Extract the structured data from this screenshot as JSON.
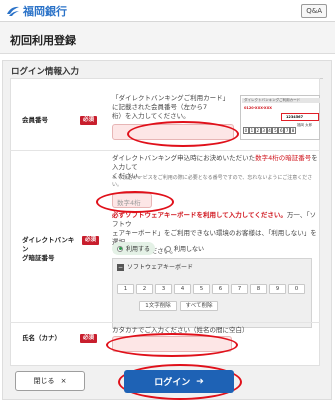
{
  "header": {
    "bank_name": "福岡銀行",
    "qa_label": "Q&A"
  },
  "page_title": "初回利用登録",
  "section_title": "ログイン情報入力",
  "member": {
    "label": "会員番号",
    "required": "必須",
    "desc_line1": "「ダイレクトバンキングご利用カード」",
    "desc_line2": "に記載された会員番号（左から7",
    "desc_line3": "桁）を入力してください。",
    "card": {
      "header": "ダイレクトバンキングご利用カード",
      "member_no": "1234567",
      "phone": "0120-XXX-XXX",
      "name": "福岡 太郎",
      "digits": [
        "0",
        "1",
        "2",
        "3",
        "4",
        "5",
        "6",
        "7",
        "8"
      ]
    }
  },
  "pin": {
    "label_line1": "ダイレクトバンキン",
    "label_line2": "グ暗証番号",
    "required": "必須",
    "desc_line1": "ダイレクトバンキング申込時にお決めいただいた",
    "desc_highlight": "数字4桁の暗証番号",
    "desc_line1_end": "を入力して",
    "desc_line2": "ください。",
    "note_line1": "※ 今後各サービスをご利用の際に必要となる番号ですので、忘れないようにご注意くださ",
    "note_line2": "い。",
    "placeholder": "数字4桁",
    "warning": "必ずソフトウェアキーボードを利用して入力してください。",
    "warning_rest1": "万一、「ソフトウ",
    "warning_rest2": "ェアキーボード」をご利用できない環境のお客様は、「利用しない」を選択",
    "warning_rest3": "し入力してください。",
    "radio_use": "利用する",
    "radio_not_use": "利用しない",
    "keyboard_title": "ソフトウェアキーボード",
    "keys": [
      "1",
      "2",
      "3",
      "4",
      "5",
      "6",
      "7",
      "8",
      "9",
      "0"
    ],
    "delete_one": "1文字削除",
    "delete_all": "すべて削除"
  },
  "name": {
    "label": "氏名（カナ）",
    "required": "必須",
    "desc": "カタカナでご入力ください（姓名の間に空白）",
    "placeholder": ""
  },
  "buttons": {
    "close": "閉じる",
    "close_icon": "×",
    "login": "ログイン",
    "login_icon": "➔"
  },
  "colors": {
    "brand_blue": "#1e62b5",
    "required_red": "#c81e2d",
    "annotation_red": "#e0101a",
    "input_pink": "#fde6e6"
  }
}
